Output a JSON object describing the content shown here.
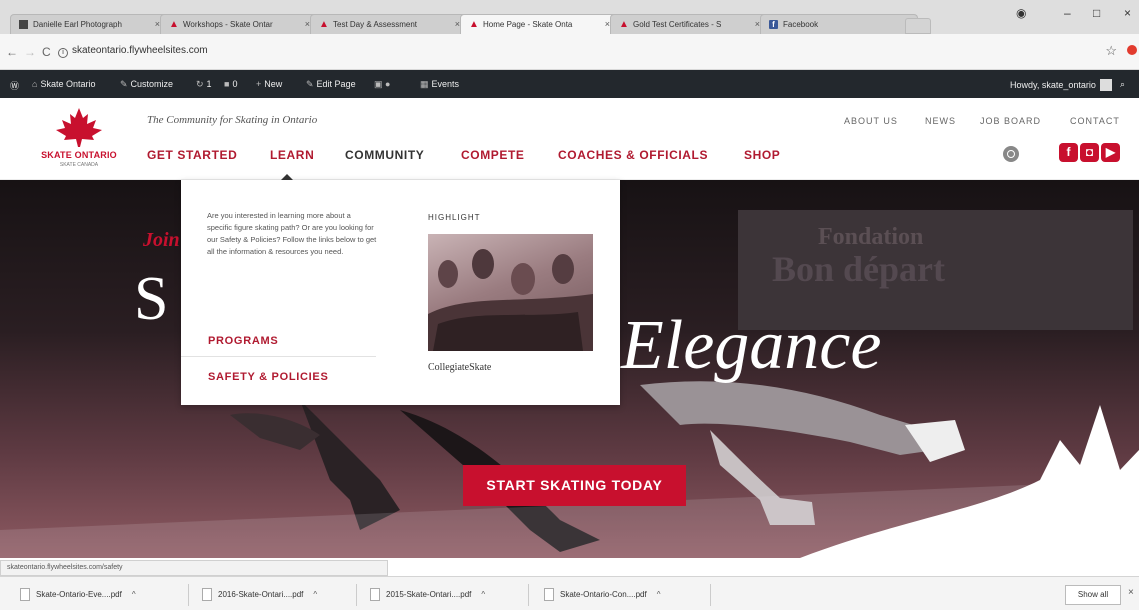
{
  "browser": {
    "tabs": [
      {
        "title": "Danielle Earl Photograph",
        "icon": "person-favicon-icon",
        "active": false
      },
      {
        "title": "Workshops - Skate Ontar",
        "icon": "skate-ontario-favicon-icon",
        "active": false
      },
      {
        "title": "Test Day & Assessment",
        "icon": "skate-ontario-favicon-icon",
        "active": false
      },
      {
        "title": "Home Page - Skate Onta",
        "icon": "skate-ontario-favicon-icon",
        "active": true
      },
      {
        "title": "Gold Test Certificates - S",
        "icon": "skate-ontario-favicon-icon",
        "active": false
      },
      {
        "title": "Facebook",
        "icon": "facebook-favicon-icon",
        "active": false
      }
    ],
    "url": "skateontario.flywheelsites.com",
    "status_url": "skateontario.flywheelsites.com/safety"
  },
  "wp_admin_bar": {
    "site_name": "Skate Ontario",
    "customize": "Customize",
    "updates_count": "1",
    "comments_count": "0",
    "new": "New",
    "edit_page": "Edit Page",
    "events": "Events",
    "greeting": "Howdy, skate_ontario"
  },
  "header": {
    "logo_text": "SKATE ONTARIO",
    "logo_subtext": "SKATE CANADA",
    "tagline": "The Community for Skating in Ontario",
    "top_links": [
      "ABOUT US",
      "NEWS",
      "JOB BOARD",
      "CONTACT"
    ],
    "main_nav": [
      "GET STARTED",
      "LEARN",
      "COMMUNITY",
      "COMPETE",
      "COACHES & OFFICIALS",
      "SHOP"
    ],
    "social": [
      "facebook",
      "instagram",
      "youtube"
    ]
  },
  "learn_menu": {
    "description": "Are you interested in learning more about a specific figure skating path? Or are you looking for our Safety & Policies? Follow the links below to get all the information & resources you need.",
    "links": [
      "PROGRAMS",
      "SAFETY & POLICIES"
    ],
    "highlight_label": "HIGHLIGHT",
    "highlight_caption": "CollegiateSkate"
  },
  "hero": {
    "join_text": "Join",
    "headline_start": "S",
    "headline_end": "Elegance",
    "banner_line1": "Fondation",
    "banner_line2": "Bon départ",
    "cta": "START SKATING TODAY"
  },
  "downloads": {
    "items": [
      "Skate-Ontario-Eve....pdf",
      "2016-Skate-Ontari....pdf",
      "2015-Skate-Ontari....pdf",
      "Skate-Ontario-Con....pdf"
    ],
    "show_all": "Show all"
  },
  "colors": {
    "brand_red": "#c8102e",
    "nav_red": "#b01a30",
    "wp_bar": "#23282d"
  }
}
